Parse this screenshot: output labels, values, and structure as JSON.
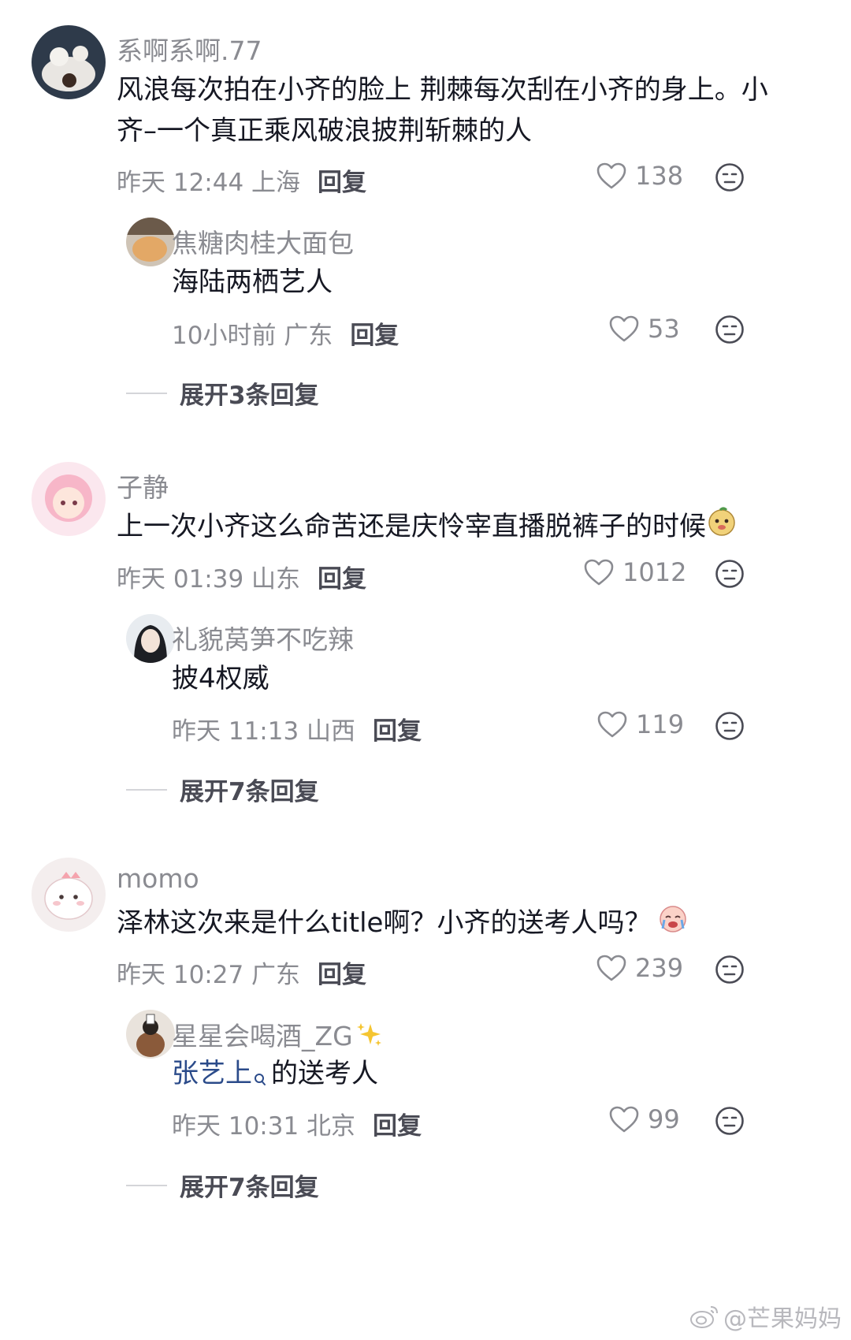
{
  "comments": [
    {
      "user": "系啊系啊.77",
      "text_line1": "风浪每次拍在小齐的脸上 荆棘每次刮在小齐的身上。小",
      "text_line2": "齐–一个真正乘风破浪披荆斩棘的人",
      "time_location": "昨天 12:44 上海",
      "reply_label": "回复",
      "likes": "138",
      "reply": {
        "user": "焦糖肉桂大面包",
        "text": "海陆两栖艺人",
        "time_location": "10小时前 广东",
        "reply_label": "回复",
        "likes": "53"
      },
      "expand_label": "展开3条回复"
    },
    {
      "user": "子静",
      "text": "上一次小齐这么命苦还是庆怜宰直播脱裤子的时候",
      "time_location": "昨天 01:39 山东",
      "reply_label": "回复",
      "likes": "1012",
      "reply": {
        "user": "礼貌莴笋不吃辣",
        "text": "披4权威",
        "time_location": "昨天 11:13 山西",
        "reply_label": "回复",
        "likes": "119"
      },
      "expand_label": "展开7条回复"
    },
    {
      "user": "momo",
      "text": "泽林这次来是什么title啊？小齐的送考人吗？",
      "time_location": "昨天 10:27 广东",
      "reply_label": "回复",
      "likes": "239",
      "reply": {
        "user": "星星会喝酒_ZG",
        "mention": "张艺上",
        "text": "的送考人",
        "time_location": "昨天 10:31 北京",
        "reply_label": "回复",
        "likes": "99"
      },
      "expand_label": "展开7条回复"
    }
  ],
  "watermark": "@芒果妈妈",
  "colors": {
    "meta": "#8a8b91",
    "text": "#161823",
    "mention": "#2b4b8a"
  }
}
